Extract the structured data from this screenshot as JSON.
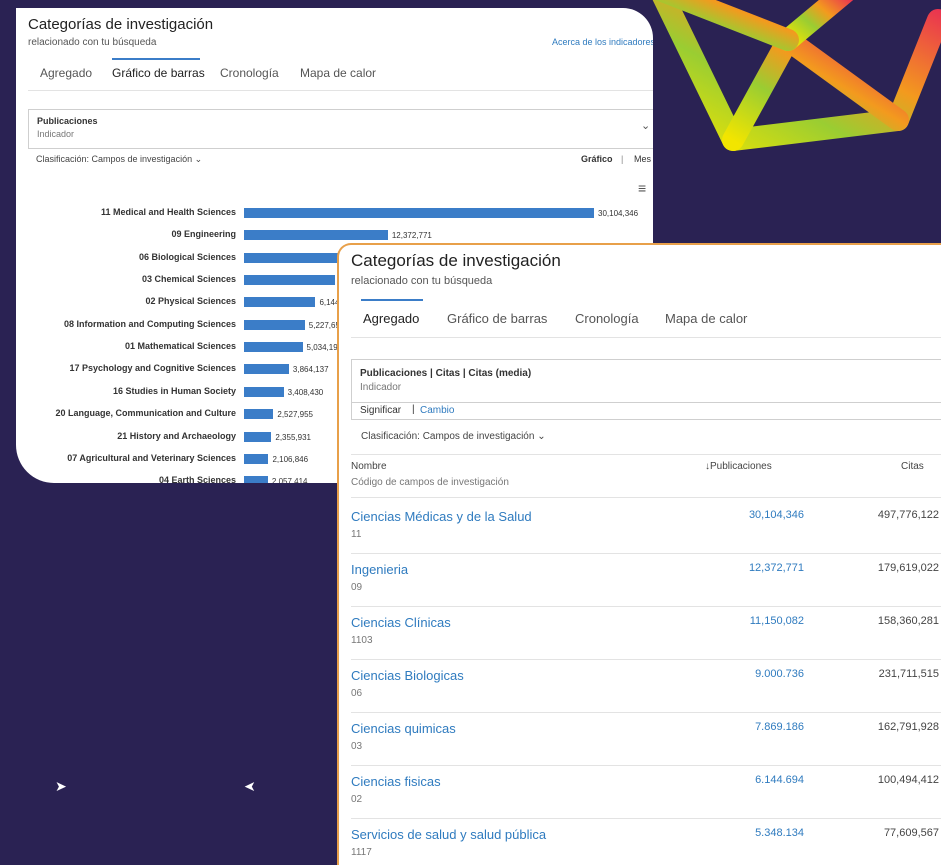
{
  "back_panel": {
    "title": "Categorías de investigación",
    "subtitle": "relacionado con tu búsqueda",
    "link": "Acerca de los indicadores",
    "tabs": [
      "Agregado",
      "Gráfico de barras",
      "Cronología",
      "Mapa de calor"
    ],
    "active_tab": 1,
    "indicator": {
      "label": "Publicaciones",
      "sub": "Indicador"
    },
    "classification": "Clasificación: Campos de investigación",
    "view_grafico": "Gráfico",
    "view_sep": "|",
    "view_mesa": "Mes",
    "chart_data": {
      "type": "bar",
      "orientation": "horizontal",
      "categories": [
        "11 Medical and Health Sciences",
        "09 Engineering",
        "06 Biological Sciences",
        "03 Chemical Sciences",
        "02 Physical Sciences",
        "08 Information and Computing Sciences",
        "01 Mathematical Sciences",
        "17 Psychology and Cognitive Sciences",
        "16 Studies in Human Society",
        "20 Language, Communication and Culture",
        "21 History and Archaeology",
        "07 Agricultural and Veterinary Sciences",
        "04 Earth Sciences"
      ],
      "values": [
        30104346,
        12372771,
        9000736,
        7869186,
        6144694,
        5227651,
        5034191,
        3864137,
        3408430,
        2527955,
        2355931,
        2106846,
        2057414
      ],
      "value_labels": [
        "30,104,346",
        "12,372,771",
        "",
        "",
        "6,144",
        "5,227,65",
        "5,034,19",
        "3,864,137",
        "3,408,430",
        "2,527,955",
        "2,355,931",
        "2,106,846",
        "2,057,414"
      ],
      "xlim": [
        0,
        30104346
      ],
      "grid": false
    }
  },
  "front_panel": {
    "title": "Categorías de investigación",
    "subtitle": "relacionado con tu búsqueda",
    "tabs": [
      "Agregado",
      "Gráfico de barras",
      "Cronología",
      "Mapa de calor"
    ],
    "active_tab": 0,
    "indicator": {
      "label": "Publicaciones | Citas | Citas (media)",
      "sub": "Indicador"
    },
    "toggle": {
      "left": "Significar",
      "sep": "|",
      "right": "Cambio"
    },
    "classification": "Clasificación: Campos de investigación",
    "table": {
      "col_name": "Nombre",
      "col_name_sub": "Código de campos de investigación",
      "col_pub": "Publicaciones",
      "col_cit": "Citas",
      "rows": [
        {
          "name": "Ciencias Médicas y de la Salud",
          "code": "11",
          "pubs": "30,104,346",
          "cites": "497,776,122"
        },
        {
          "name": "Ingenieria",
          "code": "09",
          "pubs": "12,372,771",
          "cites": "179,619,022"
        },
        {
          "name": "Ciencias Clínicas",
          "code": "1103",
          "pubs": "11,150,082",
          "cites": "158,360,281"
        },
        {
          "name": "Ciencias Biologicas",
          "code": "06",
          "pubs": "9.000.736",
          "cites": "231,711,515"
        },
        {
          "name": "Ciencias quimicas",
          "code": "03",
          "pubs": "7.869.186",
          "cites": "162,791,928"
        },
        {
          "name": "Ciencias fisicas",
          "code": "02",
          "pubs": "6.144.694",
          "cites": "100,494,412"
        },
        {
          "name": "Servicios de salud y salud pública",
          "code": "1117",
          "pubs": "5.348.134",
          "cites": "77,609,567"
        }
      ]
    }
  },
  "colors": {
    "background": "#2a2253",
    "bar": "#3b7dc8",
    "link": "#2f7bbf",
    "accent_border": "#e8a04a"
  }
}
